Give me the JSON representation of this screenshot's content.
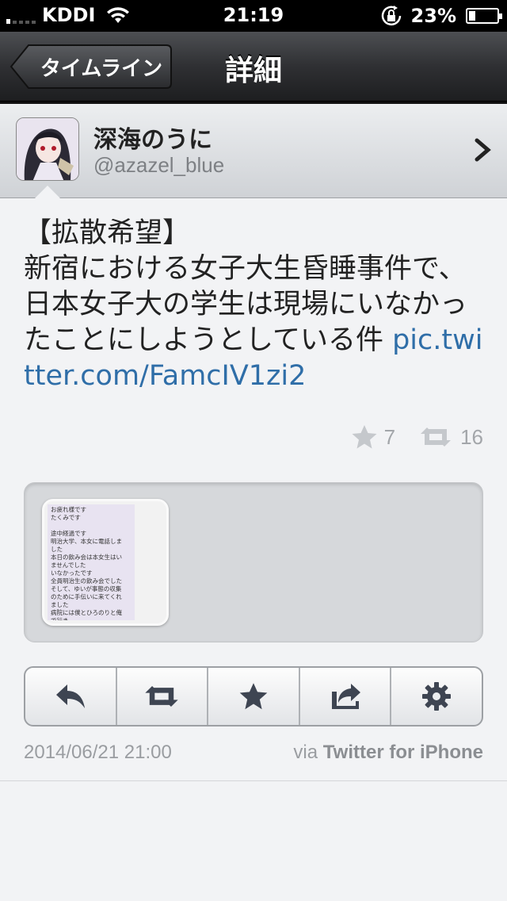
{
  "status_bar": {
    "carrier": "KDDI",
    "time": "21:19",
    "battery": "23%",
    "battery_level": 0.23,
    "signal_bars": 1
  },
  "nav": {
    "back_label": "タイムライン",
    "title": "詳細"
  },
  "user": {
    "display_name": "深海のうに",
    "screen_name": "@azazel_blue"
  },
  "tweet": {
    "text": "【拡散希望】\n新宿における女子大生昏睡事件で、日本女子大の学生は現場にいなかったことにしようとしている件 ",
    "link": "pic.twitter.com/FamcIV1zi2",
    "favorites": "7",
    "retweets": "16",
    "date": "2014/06/21 21:00",
    "via_prefix": "via ",
    "via_client": "Twitter for iPhone"
  },
  "media": {
    "thumbnail_lines": [
      "お疲れ様です",
      "たくみです",
      "",
      "途中経過です",
      "明治大学、本女に電話しま",
      "した",
      "本日の飲み会は本女生はい",
      "ませんでした",
      "いなかったです",
      "全員明治生の飲み会でした",
      "そして、ゆいが事態の収集",
      "のために手伝いに来てくれ",
      "ました",
      "病院には僕とひろのりと俺",
      "で行き"
    ]
  },
  "actions": [
    {
      "name": "reply-button",
      "icon": "reply-icon"
    },
    {
      "name": "retweet-button",
      "icon": "retweet-icon"
    },
    {
      "name": "favorite-button",
      "icon": "star-icon"
    },
    {
      "name": "share-button",
      "icon": "share-icon"
    },
    {
      "name": "settings-button",
      "icon": "gear-icon"
    }
  ],
  "colors": {
    "link": "#2f6ea8",
    "nav_bar": "#2f3033",
    "meta_text": "#9a9da1"
  }
}
